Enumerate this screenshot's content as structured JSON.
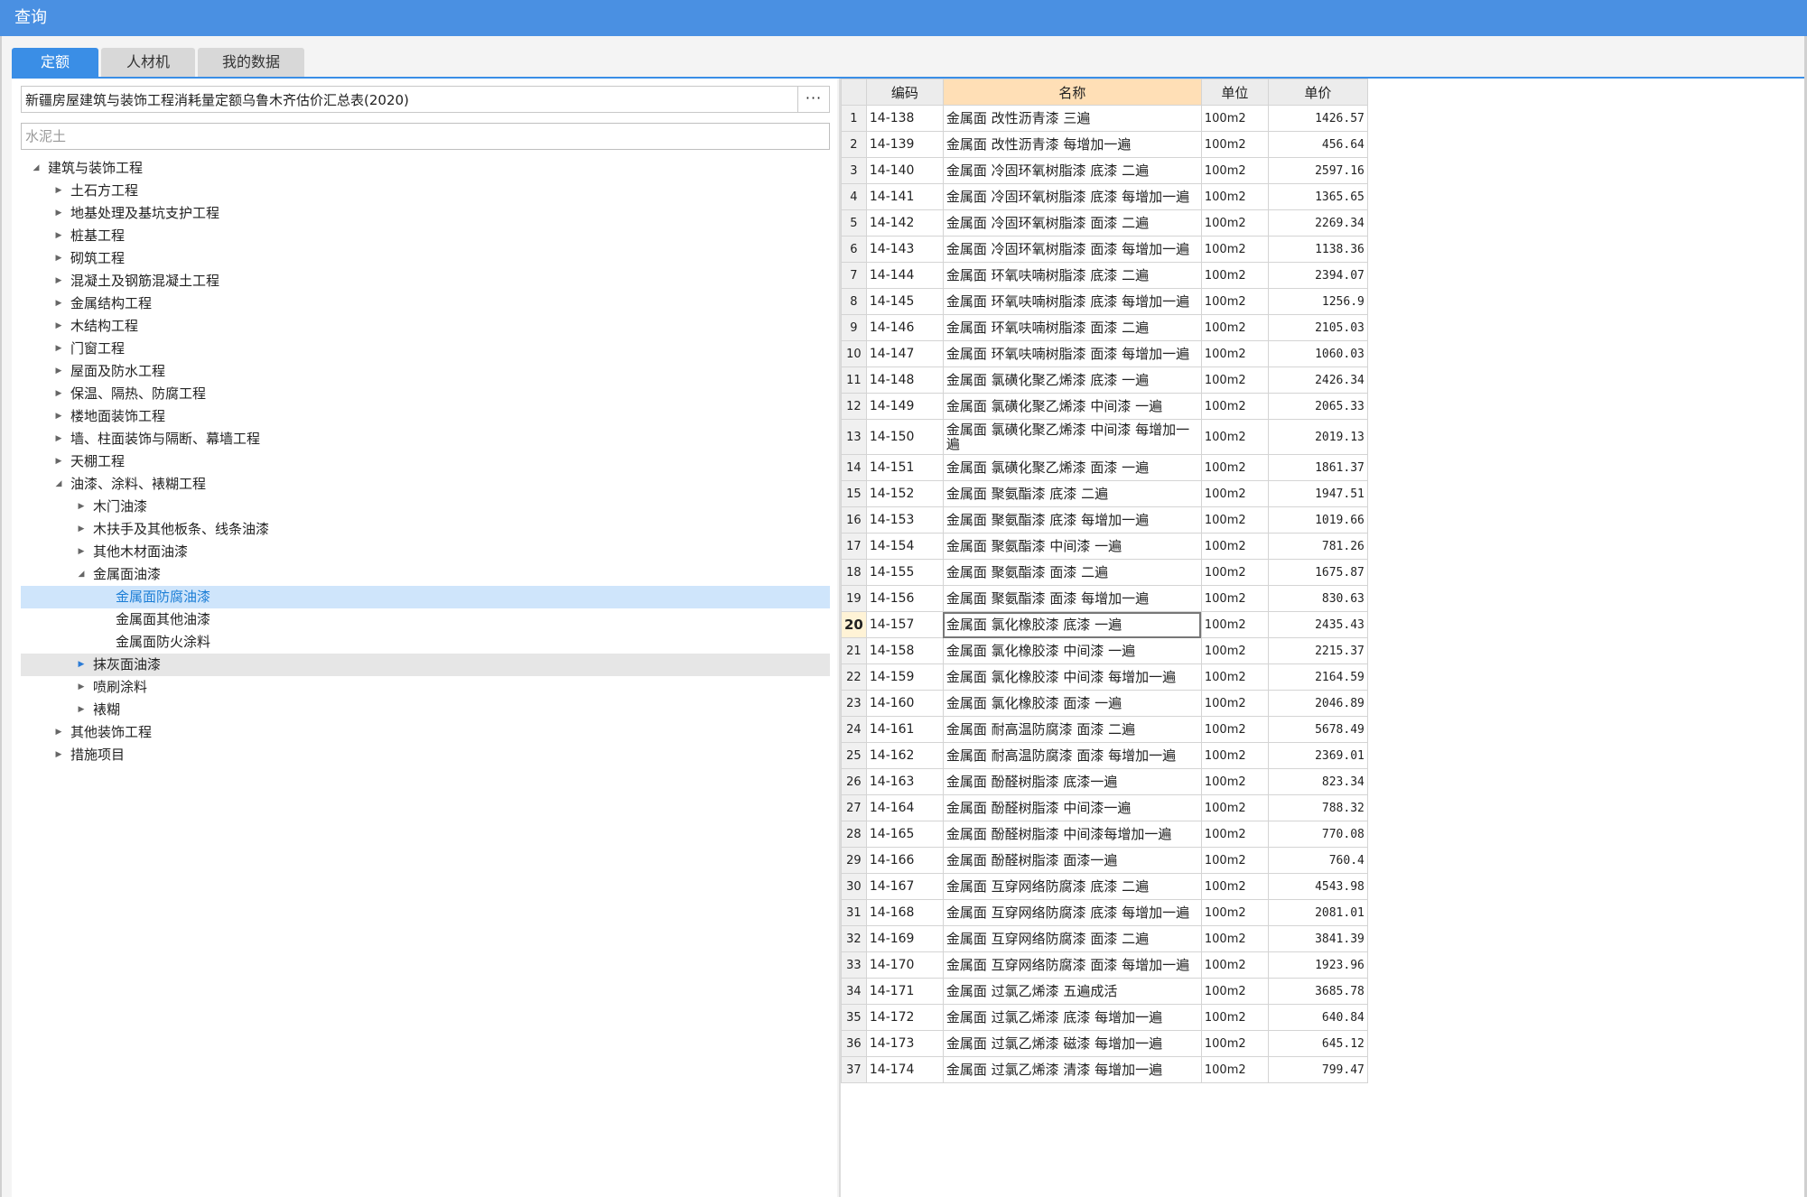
{
  "window": {
    "title": "查询"
  },
  "tabs": [
    {
      "label": "定额",
      "active": true
    },
    {
      "label": "人材机",
      "active": false
    },
    {
      "label": "我的数据",
      "active": false
    }
  ],
  "left": {
    "library": "新疆房屋建筑与装饰工程消耗量定额乌鲁木齐估价汇总表(2020)",
    "library_button": "···",
    "search_placeholder": "水泥土",
    "tree": [
      {
        "label": "建筑与装饰工程",
        "level": 0,
        "expand": "expanded"
      },
      {
        "label": "土石方工程",
        "level": 1,
        "expand": "collapsed"
      },
      {
        "label": "地基处理及基坑支护工程",
        "level": 1,
        "expand": "collapsed"
      },
      {
        "label": "桩基工程",
        "level": 1,
        "expand": "collapsed"
      },
      {
        "label": "砌筑工程",
        "level": 1,
        "expand": "collapsed"
      },
      {
        "label": "混凝土及钢筋混凝土工程",
        "level": 1,
        "expand": "collapsed"
      },
      {
        "label": "金属结构工程",
        "level": 1,
        "expand": "collapsed"
      },
      {
        "label": "木结构工程",
        "level": 1,
        "expand": "collapsed"
      },
      {
        "label": "门窗工程",
        "level": 1,
        "expand": "collapsed"
      },
      {
        "label": "屋面及防水工程",
        "level": 1,
        "expand": "collapsed"
      },
      {
        "label": "保温、隔热、防腐工程",
        "level": 1,
        "expand": "collapsed"
      },
      {
        "label": "楼地面装饰工程",
        "level": 1,
        "expand": "collapsed"
      },
      {
        "label": "墙、柱面装饰与隔断、幕墙工程",
        "level": 1,
        "expand": "collapsed"
      },
      {
        "label": "天棚工程",
        "level": 1,
        "expand": "collapsed"
      },
      {
        "label": "油漆、涂料、裱糊工程",
        "level": 1,
        "expand": "expanded"
      },
      {
        "label": "木门油漆",
        "level": 2,
        "expand": "collapsed"
      },
      {
        "label": "木扶手及其他板条、线条油漆",
        "level": 2,
        "expand": "collapsed"
      },
      {
        "label": "其他木材面油漆",
        "level": 2,
        "expand": "collapsed"
      },
      {
        "label": "金属面油漆",
        "level": 2,
        "expand": "expanded"
      },
      {
        "label": "金属面防腐油漆",
        "level": 3,
        "expand": "none",
        "state": "selected"
      },
      {
        "label": "金属面其他油漆",
        "level": 3,
        "expand": "none"
      },
      {
        "label": "金属面防火涂料",
        "level": 3,
        "expand": "none"
      },
      {
        "label": "抹灰面油漆",
        "level": 2,
        "expand": "collapsed",
        "state": "hover"
      },
      {
        "label": "喷刷涂料",
        "level": 2,
        "expand": "collapsed"
      },
      {
        "label": "裱糊",
        "level": 2,
        "expand": "collapsed"
      },
      {
        "label": "其他装饰工程",
        "level": 1,
        "expand": "collapsed"
      },
      {
        "label": "措施项目",
        "level": 1,
        "expand": "collapsed"
      }
    ]
  },
  "grid": {
    "headers": {
      "code": "编码",
      "name": "名称",
      "unit": "单位",
      "price": "单价"
    },
    "current_row": 20,
    "rows": [
      {
        "no": "1",
        "code": "14-138",
        "name": "金属面 改性沥青漆 三遍",
        "unit": "100m2",
        "price": "1426.57"
      },
      {
        "no": "2",
        "code": "14-139",
        "name": "金属面 改性沥青漆 每增加一遍",
        "unit": "100m2",
        "price": "456.64"
      },
      {
        "no": "3",
        "code": "14-140",
        "name": "金属面 冷固环氧树脂漆 底漆 二遍",
        "unit": "100m2",
        "price": "2597.16"
      },
      {
        "no": "4",
        "code": "14-141",
        "name": "金属面 冷固环氧树脂漆 底漆 每增加一遍",
        "unit": "100m2",
        "price": "1365.65"
      },
      {
        "no": "5",
        "code": "14-142",
        "name": "金属面 冷固环氧树脂漆 面漆 二遍",
        "unit": "100m2",
        "price": "2269.34"
      },
      {
        "no": "6",
        "code": "14-143",
        "name": "金属面 冷固环氧树脂漆 面漆 每增加一遍",
        "unit": "100m2",
        "price": "1138.36"
      },
      {
        "no": "7",
        "code": "14-144",
        "name": "金属面 环氧呋喃树脂漆 底漆 二遍",
        "unit": "100m2",
        "price": "2394.07"
      },
      {
        "no": "8",
        "code": "14-145",
        "name": "金属面 环氧呋喃树脂漆 底漆 每增加一遍",
        "unit": "100m2",
        "price": "1256.9"
      },
      {
        "no": "9",
        "code": "14-146",
        "name": "金属面 环氧呋喃树脂漆 面漆 二遍",
        "unit": "100m2",
        "price": "2105.03"
      },
      {
        "no": "10",
        "code": "14-147",
        "name": "金属面 环氧呋喃树脂漆 面漆 每增加一遍",
        "unit": "100m2",
        "price": "1060.03"
      },
      {
        "no": "11",
        "code": "14-148",
        "name": "金属面 氯磺化聚乙烯漆 底漆 一遍",
        "unit": "100m2",
        "price": "2426.34"
      },
      {
        "no": "12",
        "code": "14-149",
        "name": "金属面 氯磺化聚乙烯漆 中间漆 一遍",
        "unit": "100m2",
        "price": "2065.33"
      },
      {
        "no": "13",
        "code": "14-150",
        "name": "金属面 氯磺化聚乙烯漆 中间漆 每增加一遍",
        "unit": "100m2",
        "price": "2019.13",
        "tall": true
      },
      {
        "no": "14",
        "code": "14-151",
        "name": "金属面 氯磺化聚乙烯漆 面漆 一遍",
        "unit": "100m2",
        "price": "1861.37"
      },
      {
        "no": "15",
        "code": "14-152",
        "name": "金属面 聚氨酯漆 底漆 二遍",
        "unit": "100m2",
        "price": "1947.51"
      },
      {
        "no": "16",
        "code": "14-153",
        "name": "金属面 聚氨酯漆 底漆 每增加一遍",
        "unit": "100m2",
        "price": "1019.66"
      },
      {
        "no": "17",
        "code": "14-154",
        "name": "金属面 聚氨酯漆 中间漆 一遍",
        "unit": "100m2",
        "price": "781.26"
      },
      {
        "no": "18",
        "code": "14-155",
        "name": "金属面 聚氨酯漆 面漆 二遍",
        "unit": "100m2",
        "price": "1675.87"
      },
      {
        "no": "19",
        "code": "14-156",
        "name": "金属面 聚氨酯漆 面漆 每增加一遍",
        "unit": "100m2",
        "price": "830.63"
      },
      {
        "no": "20",
        "code": "14-157",
        "name": "金属面 氯化橡胶漆 底漆 一遍",
        "unit": "100m2",
        "price": "2435.43"
      },
      {
        "no": "21",
        "code": "14-158",
        "name": "金属面 氯化橡胶漆 中间漆 一遍",
        "unit": "100m2",
        "price": "2215.37"
      },
      {
        "no": "22",
        "code": "14-159",
        "name": "金属面 氯化橡胶漆 中间漆 每增加一遍",
        "unit": "100m2",
        "price": "2164.59"
      },
      {
        "no": "23",
        "code": "14-160",
        "name": "金属面 氯化橡胶漆 面漆 一遍",
        "unit": "100m2",
        "price": "2046.89"
      },
      {
        "no": "24",
        "code": "14-161",
        "name": "金属面 耐高温防腐漆 面漆 二遍",
        "unit": "100m2",
        "price": "5678.49"
      },
      {
        "no": "25",
        "code": "14-162",
        "name": "金属面 耐高温防腐漆 面漆 每增加一遍",
        "unit": "100m2",
        "price": "2369.01"
      },
      {
        "no": "26",
        "code": "14-163",
        "name": "金属面 酚醛树脂漆 底漆一遍",
        "unit": "100m2",
        "price": "823.34"
      },
      {
        "no": "27",
        "code": "14-164",
        "name": "金属面 酚醛树脂漆 中间漆一遍",
        "unit": "100m2",
        "price": "788.32"
      },
      {
        "no": "28",
        "code": "14-165",
        "name": "金属面 酚醛树脂漆 中间漆每增加一遍",
        "unit": "100m2",
        "price": "770.08"
      },
      {
        "no": "29",
        "code": "14-166",
        "name": "金属面 酚醛树脂漆 面漆一遍",
        "unit": "100m2",
        "price": "760.4"
      },
      {
        "no": "30",
        "code": "14-167",
        "name": "金属面 互穿网络防腐漆 底漆 二遍",
        "unit": "100m2",
        "price": "4543.98"
      },
      {
        "no": "31",
        "code": "14-168",
        "name": "金属面 互穿网络防腐漆 底漆 每增加一遍",
        "unit": "100m2",
        "price": "2081.01"
      },
      {
        "no": "32",
        "code": "14-169",
        "name": "金属面 互穿网络防腐漆 面漆 二遍",
        "unit": "100m2",
        "price": "3841.39"
      },
      {
        "no": "33",
        "code": "14-170",
        "name": "金属面 互穿网络防腐漆 面漆 每增加一遍",
        "unit": "100m2",
        "price": "1923.96"
      },
      {
        "no": "34",
        "code": "14-171",
        "name": "金属面 过氯乙烯漆 五遍成活",
        "unit": "100m2",
        "price": "3685.78"
      },
      {
        "no": "35",
        "code": "14-172",
        "name": "金属面 过氯乙烯漆 底漆 每增加一遍",
        "unit": "100m2",
        "price": "640.84"
      },
      {
        "no": "36",
        "code": "14-173",
        "name": "金属面 过氯乙烯漆 磁漆 每增加一遍",
        "unit": "100m2",
        "price": "645.12"
      },
      {
        "no": "37",
        "code": "14-174",
        "name": "金属面 过氯乙烯漆 清漆 每增加一遍",
        "unit": "100m2",
        "price": "799.47"
      }
    ]
  }
}
